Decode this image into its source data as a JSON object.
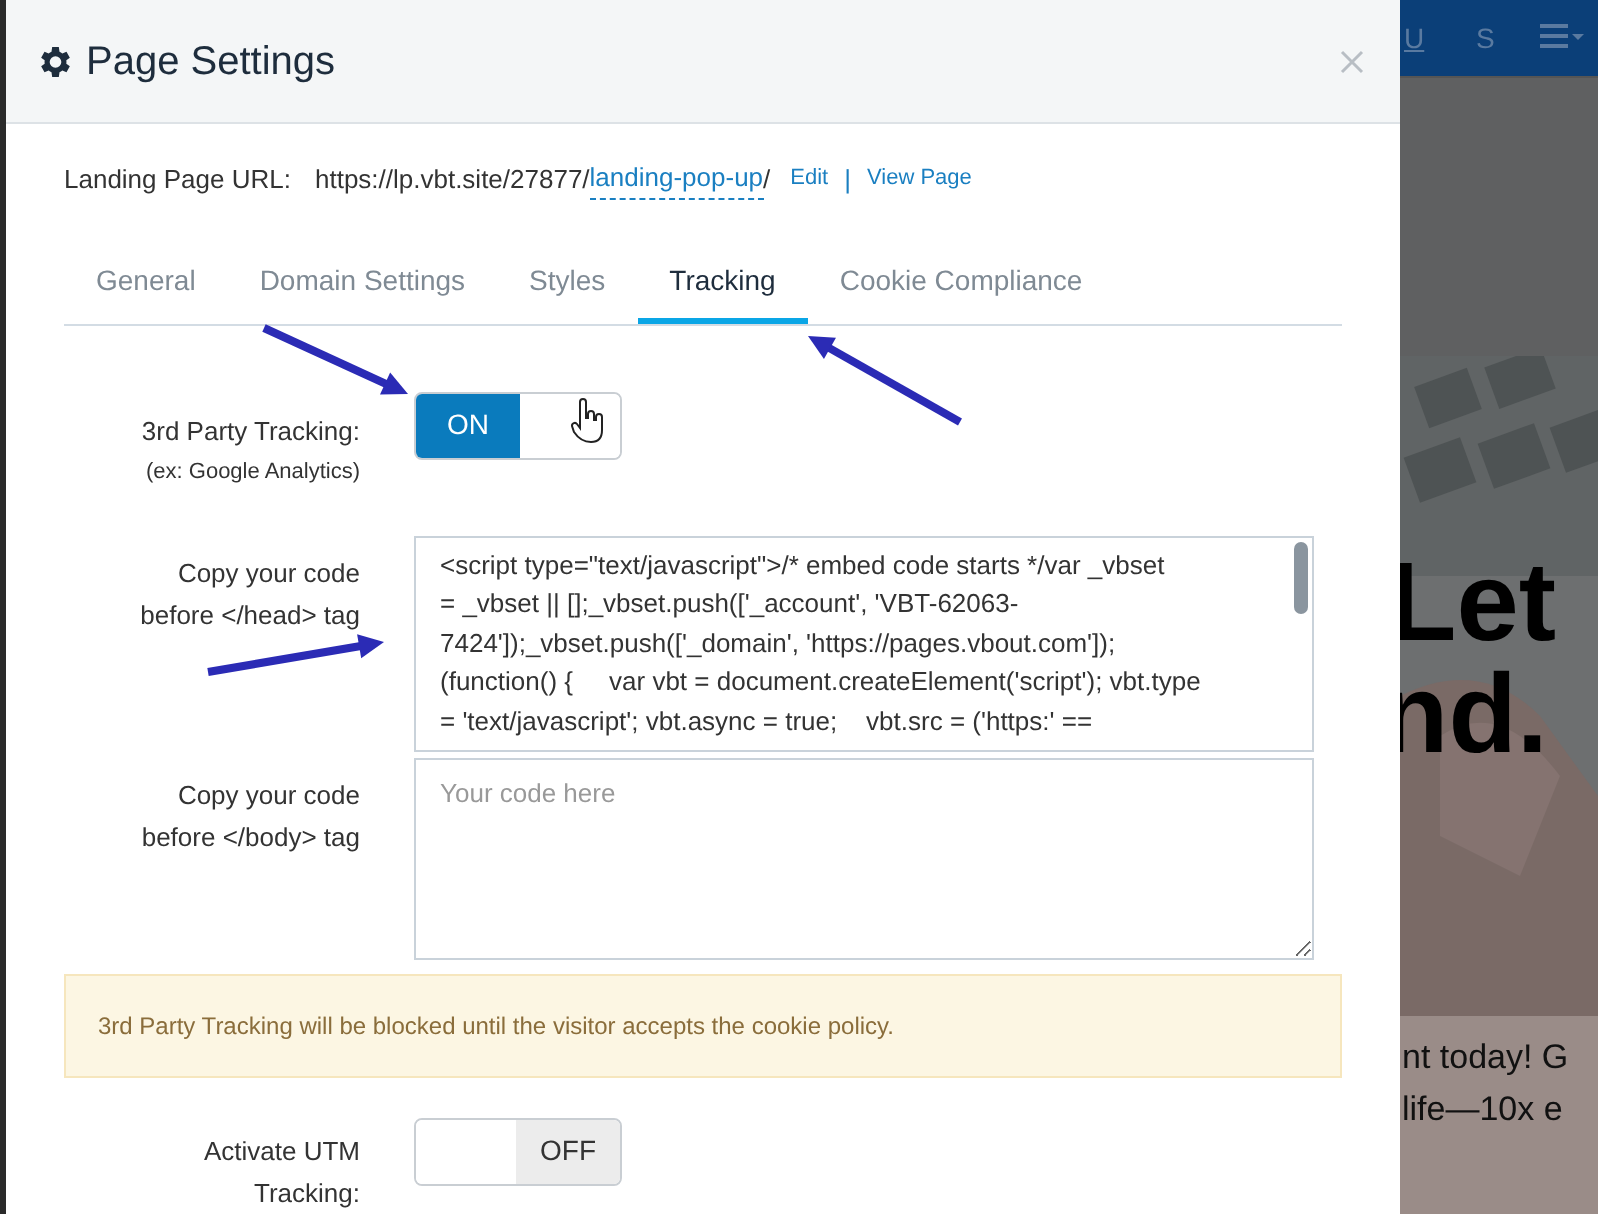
{
  "window": {
    "title": "Page Settings"
  },
  "landing_url": {
    "label": "Landing Page URL:",
    "base": "https://lp.vbt.site/27877/",
    "slug": "landing-pop-up",
    "trail": "/",
    "edit": "Edit",
    "separator": "|",
    "view": "View Page"
  },
  "tabs": [
    {
      "label": "General",
      "selected": false
    },
    {
      "label": "Domain Settings",
      "selected": false
    },
    {
      "label": "Styles",
      "selected": false
    },
    {
      "label": "Tracking",
      "selected": true
    },
    {
      "label": "Cookie Compliance",
      "selected": false
    }
  ],
  "tracking": {
    "label": "3rd Party Tracking:",
    "hint": "(ex: Google Analytics)",
    "toggle": {
      "on": true,
      "text": "ON"
    }
  },
  "head_code": {
    "label": "Copy your code before </head> tag",
    "lines": [
      "<script type=\"text/javascript\">/* embed code starts */var _vbset",
      "= _vbset || [];_vbset.push(['_account', 'VBT-62063-",
      "7424']);_vbset.push(['_domain', 'https://pages.vbout.com']);",
      "(function() {     var vbt = document.createElement('script'); vbt.type",
      "= 'text/javascript'; vbt.async = true;    vbt.src = ('https:' =="
    ]
  },
  "body_code": {
    "label": "Copy your code before </body> tag",
    "placeholder": "Your code here"
  },
  "notice": "3rd Party Tracking will be blocked until the visitor accepts the cookie policy.",
  "utm": {
    "label": "Activate UTM Tracking:",
    "toggle": {
      "on": false,
      "text": "OFF"
    }
  },
  "background": {
    "toolbar": [
      "U",
      "S"
    ],
    "headline": [
      "Let",
      "nd."
    ],
    "body": [
      "nt today! G",
      "life—10x e"
    ]
  }
}
